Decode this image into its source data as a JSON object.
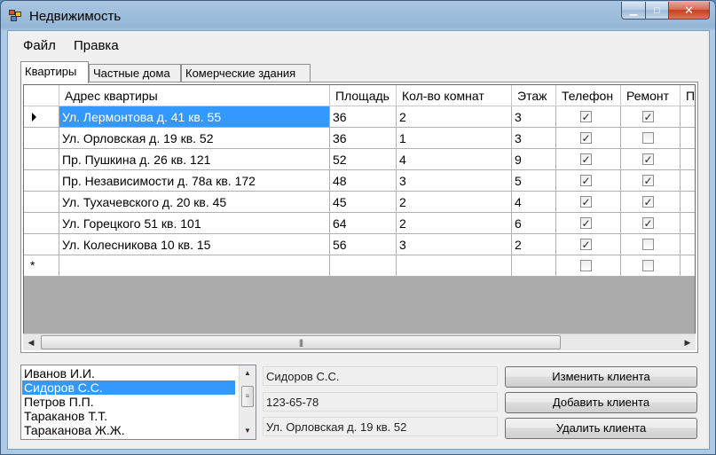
{
  "window": {
    "title": "Недвижимость"
  },
  "menu": {
    "file": "Файл",
    "edit": "Правка"
  },
  "tabs": [
    "Квартиры",
    "Частные дома",
    "Комерческие здания"
  ],
  "grid": {
    "columns": [
      "Адрес квартиры",
      "Площадь",
      "Кол-во комнат",
      "Этаж",
      "Телефон",
      "Ремонт",
      "П"
    ],
    "rows": [
      {
        "address": "Ул. Лермонтова д. 41 кв. 55",
        "area": "36",
        "rooms": "2",
        "floor": "3",
        "phone": true,
        "repair": true
      },
      {
        "address": "Ул. Орловская д. 19 кв. 52",
        "area": "36",
        "rooms": "1",
        "floor": "3",
        "phone": true,
        "repair": false
      },
      {
        "address": "Пр. Пушкина д. 26 кв. 121",
        "area": "52",
        "rooms": "4",
        "floor": "9",
        "phone": true,
        "repair": true
      },
      {
        "address": "Пр. Независимости д. 78а кв. 172",
        "area": "48",
        "rooms": "3",
        "floor": "5",
        "phone": true,
        "repair": true
      },
      {
        "address": "Ул. Тухачевского д. 20 кв. 45",
        "area": "45",
        "rooms": "2",
        "floor": "4",
        "phone": true,
        "repair": true
      },
      {
        "address": "Ул. Горецкого 51 кв. 101",
        "area": "64",
        "rooms": "2",
        "floor": "6",
        "phone": true,
        "repair": true
      },
      {
        "address": "Ул. Колесникова 10 кв. 15",
        "area": "56",
        "rooms": "3",
        "floor": "2",
        "phone": true,
        "repair": false
      }
    ],
    "selected_row": 0
  },
  "clients": {
    "items": [
      "Иванов И.И.",
      "Сидоров С.С.",
      "Петров П.П.",
      "Тараканов Т.Т.",
      "Тараканова Ж.Ж."
    ],
    "selected": 1
  },
  "client_info": {
    "name": "Сидоров С.С.",
    "phone": "123-65-78",
    "address": "Ул. Орловская д. 19 кв. 52"
  },
  "buttons": {
    "edit": "Изменить клиента",
    "add": "Добавить клиента",
    "delete": "Удалить клиента"
  }
}
